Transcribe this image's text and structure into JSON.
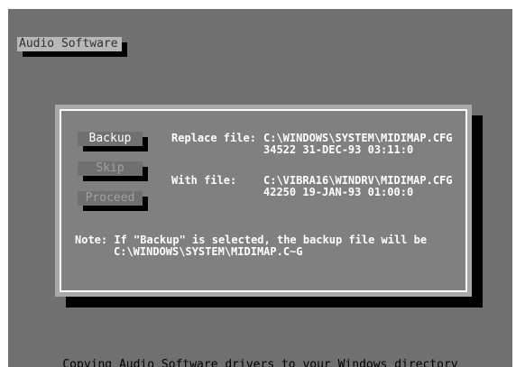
{
  "title": "Audio Software",
  "buttons": {
    "backup": "Backup",
    "skip": "Skip",
    "proceed": "Proceed"
  },
  "replace": {
    "label": "Replace file:",
    "path": "C:\\WINDOWS\\SYSTEM\\MIDIMAP.CFG",
    "info": "34522 31-DEC-93 03:11:0"
  },
  "with": {
    "label": "With file:",
    "path": "C:\\VIBRA16\\WINDRV\\MIDIMAP.CFG",
    "info": "42250 19-JAN-93 01:00:0"
  },
  "note": {
    "line1": "Note: If \"Backup\" is selected, the backup file will be",
    "line2": "C:\\WINDOWS\\SYSTEM\\MIDIMAP.C~G"
  },
  "status": "Copying Audio Software drivers to your Windows directory"
}
